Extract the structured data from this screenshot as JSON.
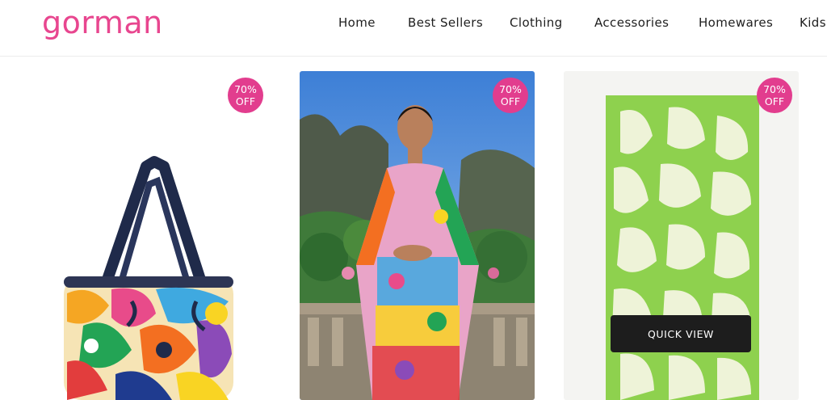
{
  "brand": {
    "logo_text": "gorman",
    "accent_color": "#e23d8e"
  },
  "nav": {
    "items": [
      {
        "label": "Home"
      },
      {
        "label": "Best Sellers"
      },
      {
        "label": "Clothing"
      },
      {
        "label": "Accessories"
      },
      {
        "label": "Homewares"
      },
      {
        "label": "Kids"
      }
    ]
  },
  "products": [
    {
      "badge_line1": "70%",
      "badge_line2": "OFF",
      "image": "patterned-cooler-bag-icon"
    },
    {
      "badge_line1": "70%",
      "badge_line2": "OFF",
      "image": "model-in-printed-dress-photo"
    },
    {
      "badge_line1": "70%",
      "badge_line2": "OFF",
      "image": "green-leaf-beach-towel-icon",
      "quick_view_label": "QUICK VIEW"
    }
  ]
}
